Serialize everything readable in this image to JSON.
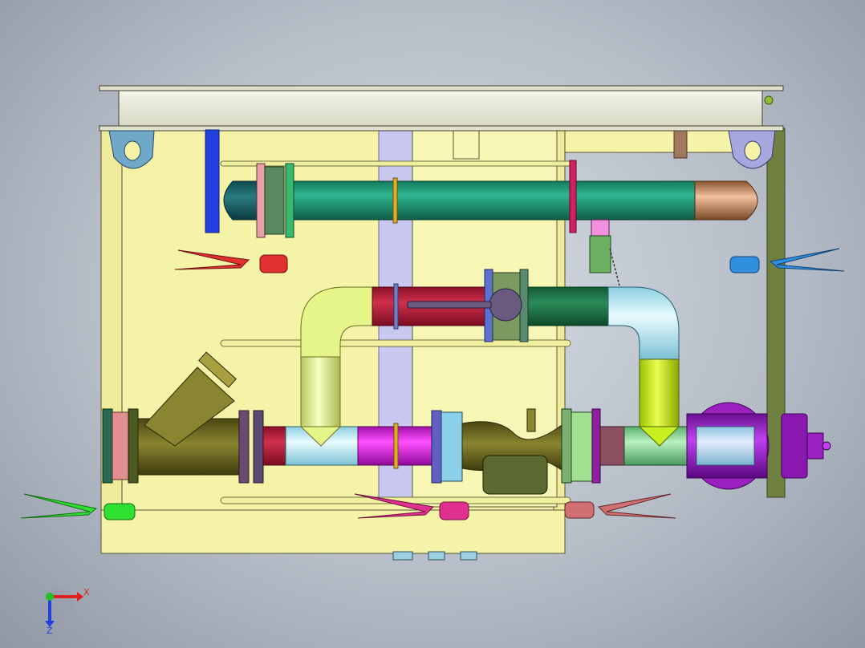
{
  "viewport": {
    "background_center": "#d8dde4",
    "background_edge": "#8f98a5"
  },
  "triad": {
    "x_label": "X",
    "z_label": "Z",
    "x_color": "#e02020",
    "y_color": "#20c020",
    "z_color": "#2040e0"
  },
  "colors": {
    "frame": "#f5f3a8",
    "frame_edge": "#55553a",
    "top_beam": "#e9ead9",
    "lifting_lug": "#6fa8c8",
    "header_pipe_green": "#1f9a78",
    "elbow_copper": "#c98a5e",
    "red_section": "#c0203c",
    "dark_green_section": "#1f7a4a",
    "light_cyan_elbow": "#bfe9f2",
    "yellow_green_elbow": "#e6f58a",
    "lime_section": "#c8f020",
    "y_strainer": "#6f6a1e",
    "magenta_section": "#e020e0",
    "purple_outlet": "#9a20c0",
    "lavender_column": "#c9c8f0",
    "vertical_support_green": "#6f8040",
    "handle_red": "#e03030",
    "handle_green": "#30e030",
    "handle_pink": "#e03090",
    "handle_rose": "#d07070",
    "handle_blue": "#3090e0"
  }
}
